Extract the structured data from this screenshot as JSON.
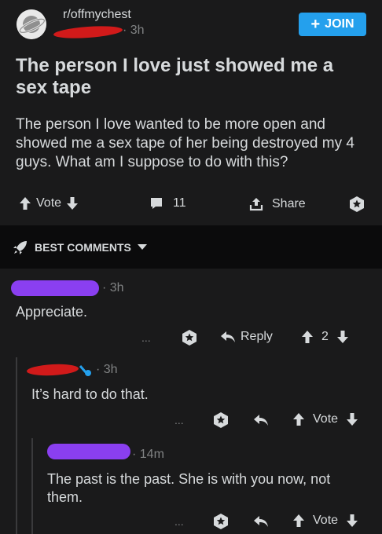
{
  "post": {
    "subreddit": "r/offmychest",
    "age": "3h",
    "join_label": "JOIN",
    "title": "The person I love just showed me a sex tape",
    "body": "The person I love wanted to be more open and showed me a sex tape of her being destroyed my 4 guys. What am I suppose to do with this?",
    "vote_label": "Vote",
    "comment_count": "11",
    "share_label": "Share"
  },
  "sort": {
    "label": "BEST COMMENTS"
  },
  "comments": [
    {
      "age": "3h",
      "text": "Appreciate.",
      "more": "...",
      "reply_label": "Reply",
      "score": "2"
    },
    {
      "age": "3h",
      "text": "It’s hard to do that.",
      "more": "...",
      "vote_label": "Vote"
    },
    {
      "age": "14m",
      "text": "The past is the past. She is with you now, not them.",
      "more": "...",
      "vote_label": "Vote"
    }
  ],
  "colors": {
    "accent": "#24a0ed",
    "redaction_red": "#d11a1a",
    "redaction_purple": "#8a3ff0",
    "background": "#1a1a1b"
  }
}
